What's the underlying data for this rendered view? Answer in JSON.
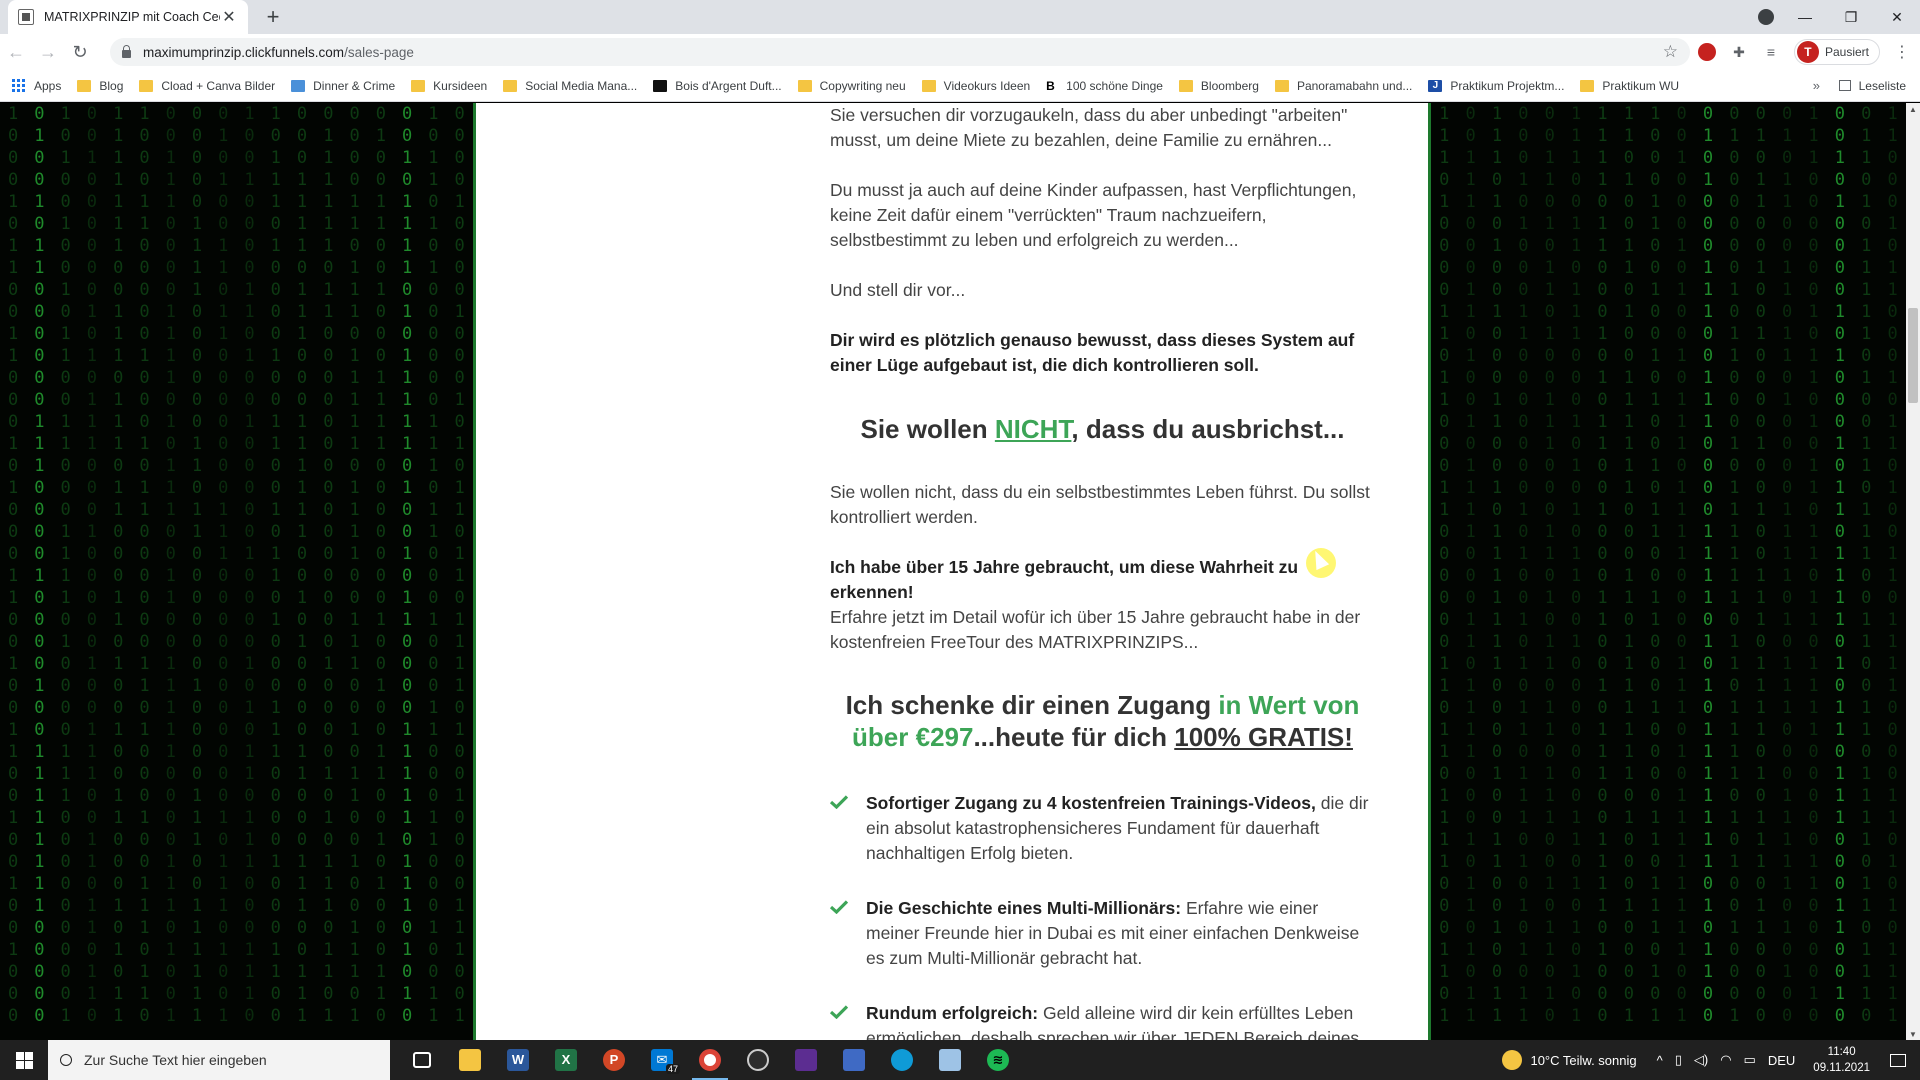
{
  "browser": {
    "tab_title": "MATRIXPRINZIP mit Coach Cecil",
    "url_host": "maximumprinzip.clickfunnels.com",
    "url_path": "/sales-page",
    "profile_initial": "T",
    "profile_label": "Pausiert",
    "bookmarks": [
      "Apps",
      "Blog",
      "Cload + Canva Bilder",
      "Dinner & Crime",
      "Kursideen",
      "Social Media Mana...",
      "Bois d'Argent Duft...",
      "Copywriting neu",
      "Videokurs Ideen",
      "100 schöne Dinge",
      "Bloomberg",
      "Panoramabahn und...",
      "Praktikum Projektm...",
      "Praktikum WU"
    ],
    "reading_list": "Leseliste"
  },
  "page": {
    "p1": "Sie versuchen dir vorzugaukeln, dass du aber unbedingt \"arbeiten\" musst, um deine Miete zu bezahlen, deine Familie zu ernähren...",
    "p2": "Du musst ja auch auf deine Kinder aufpassen, hast Verpflichtungen, keine Zeit dafür einem \"verrückten\" Traum nachzueifern, selbstbestimmt zu leben und erfolgreich zu werden...",
    "p3": "Und stell dir vor...",
    "p4": "Dir wird es plötzlich genauso bewusst, dass dieses System auf einer Lüge aufgebaut ist, die dich kontrollieren soll.",
    "h1_pre": "Sie wollen ",
    "h1_em": "NICHT",
    "h1_post": ", dass du ausbrichst...",
    "p5": "Sie wollen nicht, dass du ein selbstbestimmtes Leben führst. Du sollst kontrolliert werden.",
    "p6": "Ich habe über 15 Jahre gebraucht, um diese Wahrheit zu erkennen!",
    "p7": "Erfahre jetzt im Detail wofür ich über 15 Jahre gebraucht habe in der kostenfreien FreeTour des MATRIXPRINZIPS...",
    "h2_pre": "Ich schenke dir einen Zugang ",
    "h2_em": "in Wert von über €297",
    "h2_mid": "...heute für dich ",
    "h2_u": "100% GRATIS!",
    "bullets": [
      {
        "bold": "Sofortiger Zugang zu 4 kostenfreien Trainings-Videos,",
        "text": " die dir ein absolut katastrophensicheres Fundament für dauerhaft nachhaltigen Erfolg bieten."
      },
      {
        "bold": "Die Geschichte eines Multi-Millionärs:",
        "text": " Erfahre wie einer meiner Freunde hier in Dubai es mit einer einfachen Denkweise es zum Multi-Millionär gebracht hat."
      },
      {
        "bold": "Rundum erfolgreich:",
        "text": " Geld alleine wird dir kein erfülltes Leben ermöglichen, deshalb sprechen wir über JEDEN Bereich deines"
      }
    ]
  },
  "taskbar": {
    "search_placeholder": "Zur Suche Text hier eingeben",
    "mail_badge": "47",
    "weather": "10°C  Teilw. sonnig",
    "language": "DEU",
    "time": "11:40",
    "date": "09.11.2021"
  },
  "colors": {
    "accent_green": "#3da557",
    "frame_green": "#1e7a2e"
  }
}
